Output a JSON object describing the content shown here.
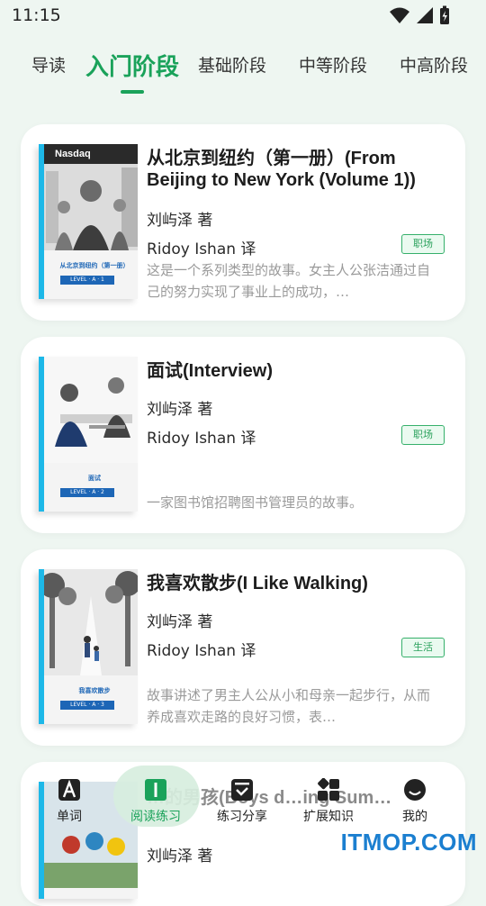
{
  "status": {
    "time": "11:15"
  },
  "tabs": [
    {
      "label": "导读"
    },
    {
      "label": "入门阶段",
      "active": true
    },
    {
      "label": "基础阶段"
    },
    {
      "label": "中等阶段"
    },
    {
      "label": "中高阶段"
    }
  ],
  "books": [
    {
      "title": "从北京到纽约（第一册）(From Beijing to New York (Volume 1))",
      "author": "刘屿泽 著",
      "translator": "Ridoy Ishan 译",
      "tag": "职场",
      "description": "这是一个系列类型的故事。女主人公张洁通过自己的努力实现了事业上的成功，…",
      "cover_title": "从北京到纽约（第一册）",
      "cover_level": "LEVEL · A · 1",
      "cover_sign": "Nasdaq"
    },
    {
      "title": "面试(Interview)",
      "author": "刘屿泽 著",
      "translator": "Ridoy Ishan 译",
      "tag": "职场",
      "description": "一家图书馆招聘图书管理员的故事。",
      "cover_title": "面试",
      "cover_level": "LEVEL · A · 2"
    },
    {
      "title": "我喜欢散步(I Like Walking)",
      "author": "刘屿泽 著",
      "translator": "Ridoy Ishan 译",
      "tag": "生活",
      "description": "故事讲述了男主人公从小和母亲一起步行，从而养成喜欢走路的良好习惯，表…",
      "cover_title": "我喜欢散步",
      "cover_level": "LEVEL · A · 3"
    },
    {
      "title": "…的男孩(Boys d…ing Sum…",
      "author": "刘屿泽 著"
    }
  ],
  "bottom_nav": [
    {
      "label": "单词",
      "icon": "letter-a-icon"
    },
    {
      "label": "阅读练习",
      "icon": "book-icon",
      "active": true
    },
    {
      "label": "练习分享",
      "icon": "share-checkbox-icon"
    },
    {
      "label": "扩展知识",
      "icon": "grid-icon"
    },
    {
      "label": "我的",
      "icon": "smile-icon"
    }
  ],
  "colors": {
    "accent": "#1aa25a",
    "background": "#eef6f1",
    "cover_spine": "#1db8e8"
  },
  "watermark": "ITMOP.COM"
}
